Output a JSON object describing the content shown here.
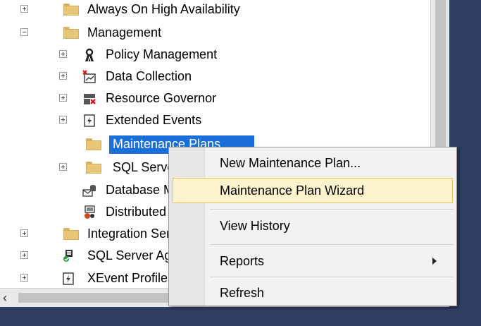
{
  "tree": {
    "items": [
      {
        "label": "Always On High Availability",
        "expander": "plus",
        "icon": "folder-icon"
      },
      {
        "label": "Management",
        "expander": "minus",
        "icon": "folder-icon"
      },
      {
        "label": "Policy Management",
        "expander": "plus",
        "icon": "policy-icon"
      },
      {
        "label": "Data Collection",
        "expander": "plus",
        "icon": "data-collection-icon"
      },
      {
        "label": "Resource Governor",
        "expander": "plus",
        "icon": "resource-governor-icon"
      },
      {
        "label": "Extended Events",
        "expander": "plus",
        "icon": "extended-events-icon"
      },
      {
        "label": "Maintenance Plans",
        "expander": "none",
        "icon": "folder-icon",
        "selected": true
      },
      {
        "label": "SQL Server Logs",
        "expander": "plus",
        "icon": "folder-icon"
      },
      {
        "label": "Database Mail",
        "expander": "none",
        "icon": "database-mail-icon"
      },
      {
        "label": "Distributed Transaction Coordinator",
        "expander": "none",
        "icon": "dtc-icon"
      },
      {
        "label": "Integration Services Catalogs",
        "expander": "plus",
        "icon": "folder-icon"
      },
      {
        "label": "SQL Server Agent",
        "expander": "plus",
        "icon": "agent-icon"
      },
      {
        "label": "XEvent Profiler",
        "expander": "plus",
        "icon": "xevent-icon"
      }
    ]
  },
  "context_menu": {
    "items": [
      {
        "label": "New Maintenance Plan..."
      },
      {
        "label": "Maintenance Plan Wizard",
        "highlighted": true
      },
      {
        "label": "View History"
      },
      {
        "label": "Reports",
        "submenu": true
      },
      {
        "label": "Refresh"
      }
    ]
  },
  "colors": {
    "selection": "#1a6fd8",
    "menu_hover_fill": "#fcf3cc",
    "menu_hover_border": "#e5c365",
    "ide_frame": "#2e3f63"
  }
}
